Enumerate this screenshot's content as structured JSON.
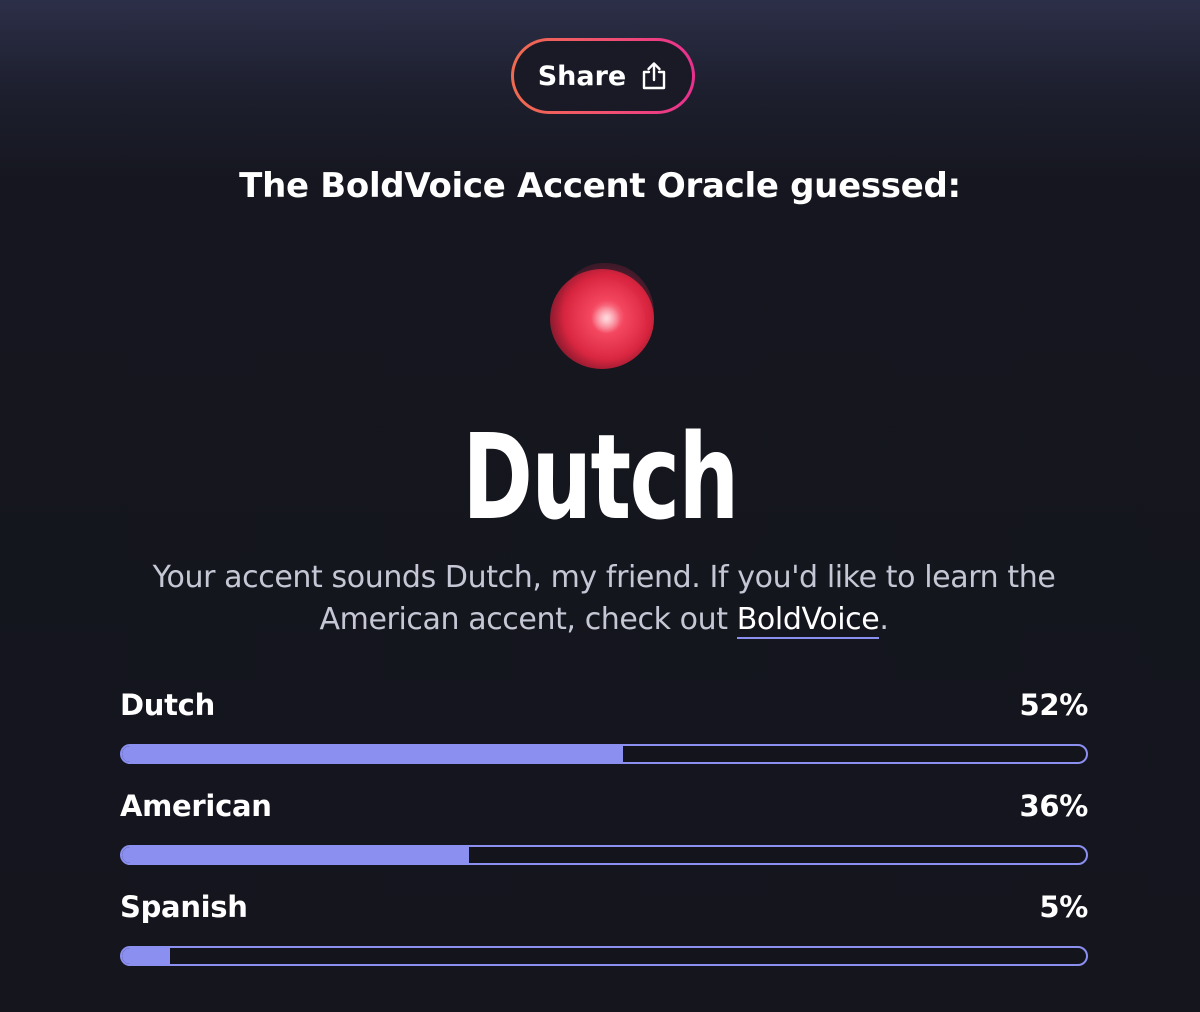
{
  "share": {
    "label": "Share",
    "icon": "share-upload-icon"
  },
  "headline": "The BoldVoice Accent Oracle guessed:",
  "orb_icon": "accent-orb-graphic",
  "result": {
    "accent": "Dutch",
    "description_prefix": "Your accent sounds Dutch, my friend. If you'd like to learn the American accent, check out ",
    "link_label": "BoldVoice",
    "description_suffix": "."
  },
  "scores": [
    {
      "label": "Dutch",
      "percent_label": "52%",
      "value": 52
    },
    {
      "label": "American",
      "percent_label": "36%",
      "value": 36
    },
    {
      "label": "Spanish",
      "percent_label": "5%",
      "value": 5
    }
  ],
  "colors": {
    "accent_bar": "#8b8ff0",
    "share_gradient_start": "#f06b4e",
    "share_gradient_end": "#ea2f8f",
    "background": "#14151d"
  }
}
